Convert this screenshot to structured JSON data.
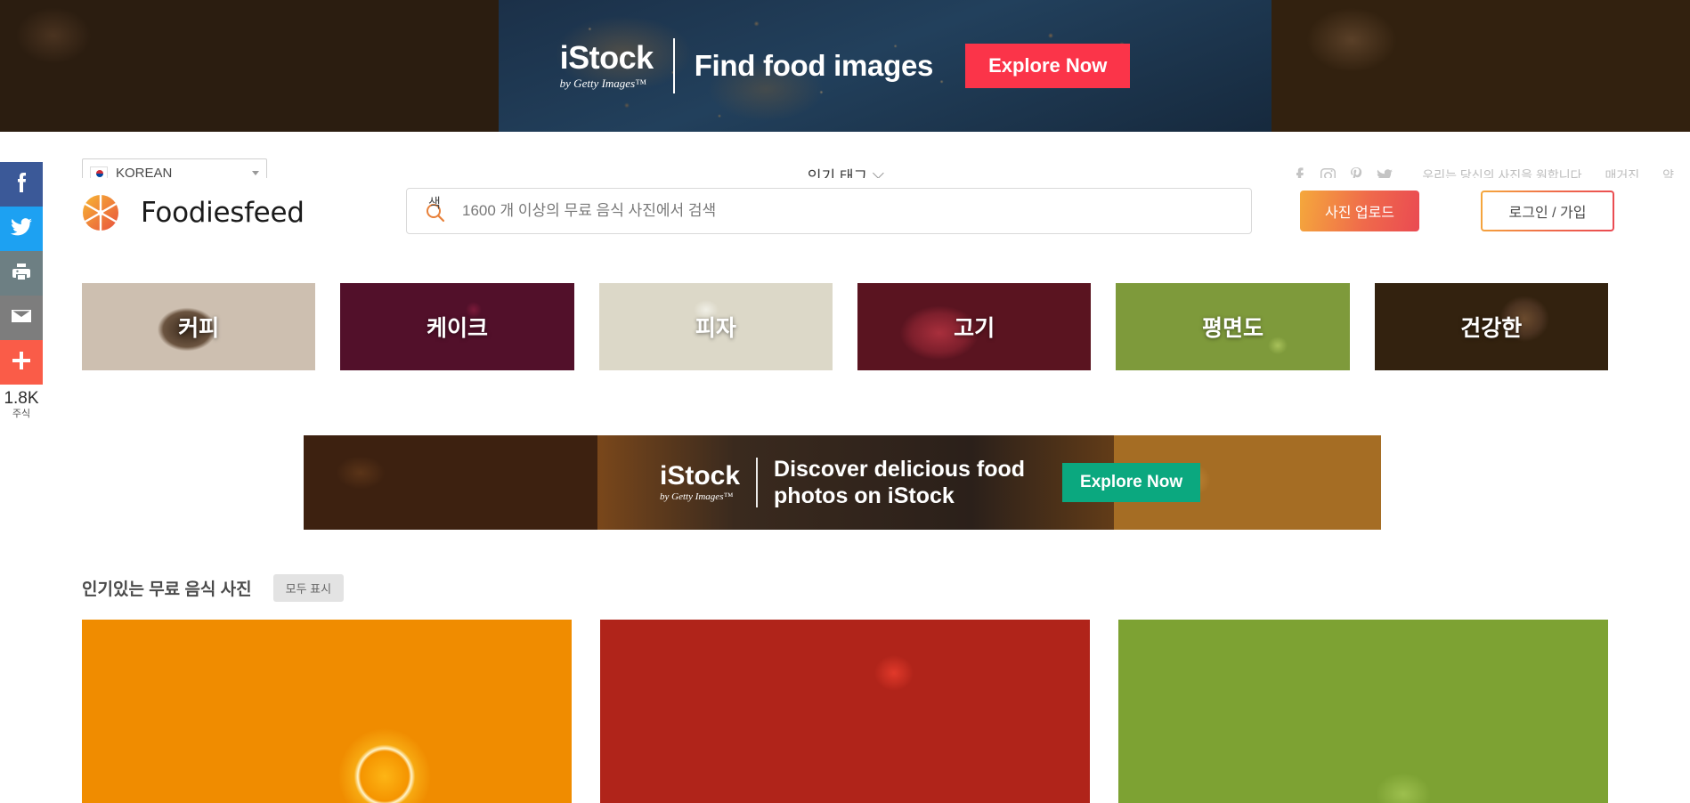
{
  "top_banner": {
    "brand": "iStock",
    "brand_sub": "by Getty Images™",
    "headline": "Find food images",
    "cta": "Explore Now",
    "cta_color": "#fb3449"
  },
  "share_rail": {
    "items": [
      {
        "name": "facebook",
        "color": "#3b5998"
      },
      {
        "name": "twitter",
        "color": "#1da1f2"
      },
      {
        "name": "print",
        "color": "#6d7f83"
      },
      {
        "name": "email",
        "color": "#7d7d7d"
      },
      {
        "name": "plus",
        "color": "#fa5c48"
      }
    ],
    "count": "1.8K",
    "count_label": "주식"
  },
  "topnav": {
    "language": "KOREAN",
    "center_link": "인기 태그",
    "social": [
      "facebook",
      "instagram",
      "pinterest",
      "twitter"
    ],
    "links": [
      "우리는 당신의 사진을 원합니다",
      "매거진",
      "약"
    ]
  },
  "header": {
    "brand": "Foodiesfeed",
    "search_placeholder": "1600 개 이상의 무료 음식 사진에서 검색",
    "search_value": "",
    "search_glyph": "색",
    "upload_label": "사진 업로드",
    "login_label": "로그인 / 가입"
  },
  "tiles": [
    {
      "label": "커피",
      "style": "t-coffee"
    },
    {
      "label": "케이크",
      "style": "t-cake"
    },
    {
      "label": "피자",
      "style": "t-pizza"
    },
    {
      "label": "고기",
      "style": "t-meat"
    },
    {
      "label": "평면도",
      "style": "t-board"
    },
    {
      "label": "건강한",
      "style": "t-avocado"
    }
  ],
  "mid_banner": {
    "brand": "iStock",
    "brand_sub": "by Getty Images™",
    "headline": "Discover delicious food photos on iStock",
    "cta": "Explore Now",
    "cta_color": "#0ba87f"
  },
  "section": {
    "title": "인기있는 무료 음식 사진",
    "show_all": "모두 표시"
  },
  "grid": [
    {
      "alt": "orange-slice-on-blue",
      "style": "g-orange"
    },
    {
      "alt": "tomatoes-garlic-on-wood",
      "style": "g-board"
    },
    {
      "alt": "light-gray-vegetable",
      "style": "g-light"
    }
  ]
}
